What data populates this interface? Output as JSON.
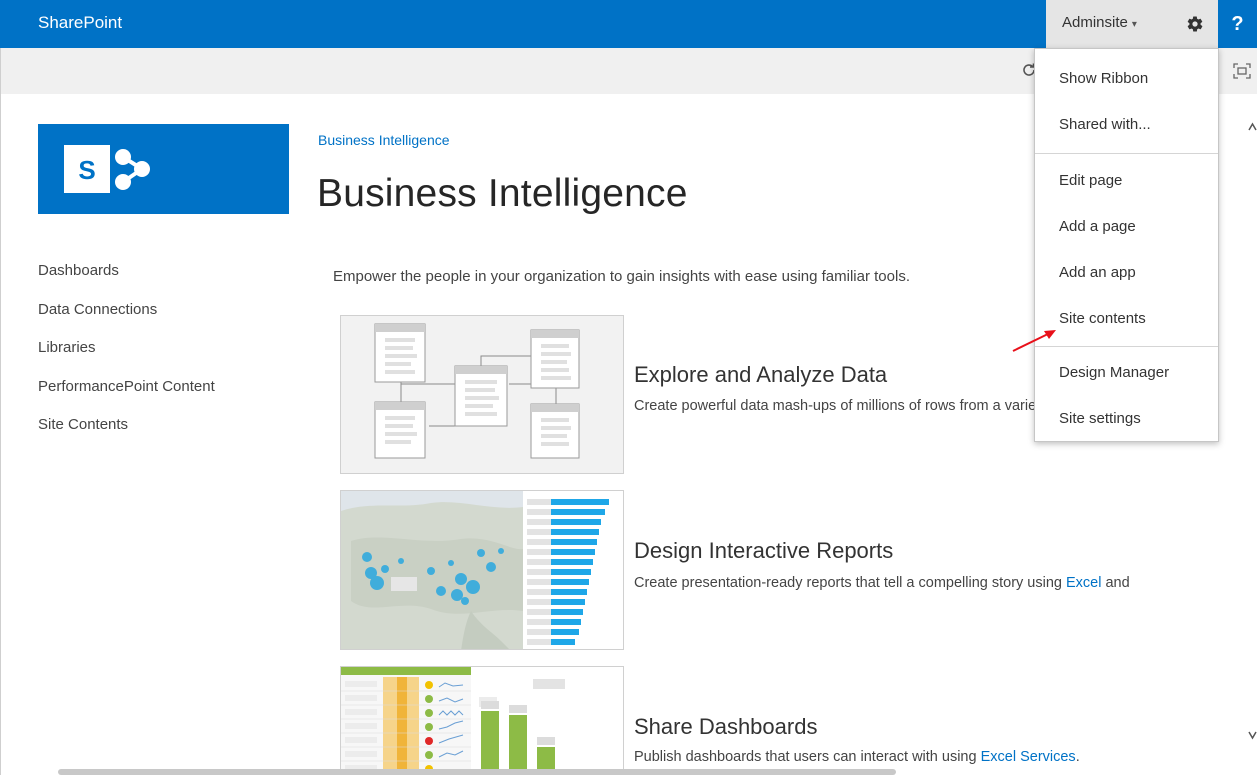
{
  "suite_bar": {
    "brand": "SharePoint",
    "user_name": "Adminsite",
    "user_caret": "▾",
    "help_label": "?",
    "gear_icon": "gear-icon",
    "accent_color": "#0072c6"
  },
  "ribbon": {
    "sync_icon": "sync-icon",
    "focus_icon": "focus-mode-icon"
  },
  "logo": {
    "letter": "S",
    "background": "#0072c6"
  },
  "left_nav": {
    "items": [
      "Dashboards",
      "Data Connections",
      "Libraries",
      "PerformancePoint Content",
      "Site Contents"
    ]
  },
  "main": {
    "breadcrumb": "Business Intelligence",
    "title": "Business Intelligence",
    "intro": "Empower the people in your organization to gain insights with ease using familiar tools.",
    "tiles": [
      {
        "heading": "Explore and Analyze Data",
        "description": "Create powerful data mash-ups of millions of rows from a variety of data sources"
      },
      {
        "heading": "Design Interactive Reports",
        "description_prefix": "Create presentation-ready reports that tell a compelling story using ",
        "description_link": "Excel",
        "description_suffix": " and"
      },
      {
        "heading": "Share Dashboards",
        "description_prefix": "Publish dashboards that users can interact with using ",
        "description_link": "Excel Services",
        "description_suffix": "."
      }
    ]
  },
  "settings_menu": {
    "items": [
      "Show Ribbon",
      "Shared with...",
      "Edit page",
      "Add a page",
      "Add an app",
      "Site contents",
      "Design Manager",
      "Site settings"
    ],
    "annotation_arrow_color": "#e8101a"
  }
}
